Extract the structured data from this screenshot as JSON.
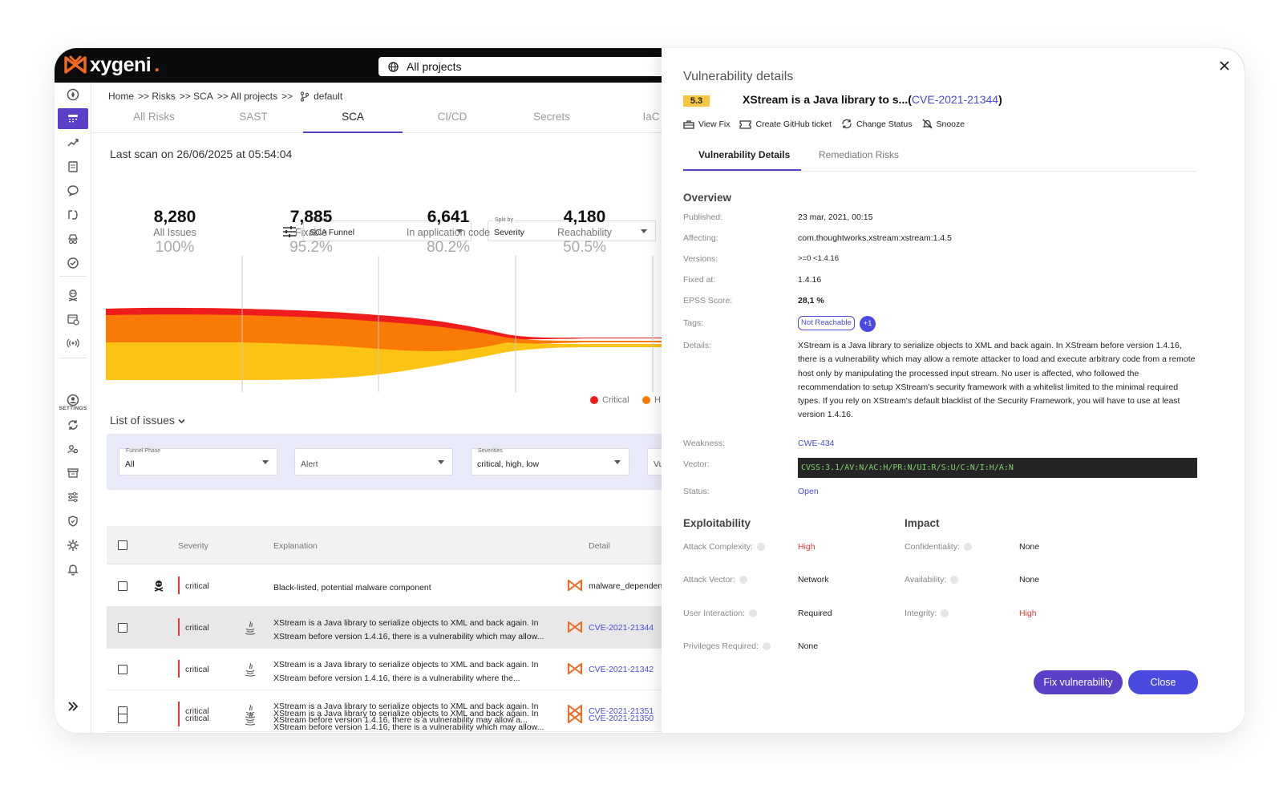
{
  "brand": {
    "name": "xygeni",
    "accent": "#f26a21",
    "primary": "#5b3fc8",
    "link": "#4a4ae0"
  },
  "header": {
    "project_selector": "All projects"
  },
  "sidebar": {
    "settings_label": "SETTINGS"
  },
  "breadcrumb": {
    "items": [
      "Home",
      ">> Risks",
      ">> SCA",
      ">> All projects",
      ">>"
    ],
    "branch": "default"
  },
  "tabs": [
    "All Risks",
    "SAST",
    "SCA",
    "CI/CD",
    "Secrets",
    "IaC"
  ],
  "active_tab": "SCA",
  "last_scan": "Last scan on 26/06/2025 at 05:54:04",
  "funnel_select": {
    "label": "Funnel",
    "value": "SCA Funnel"
  },
  "split_select": {
    "label": "Split by",
    "value": "Severity"
  },
  "metrics": [
    {
      "number": "8,280",
      "label": "All Issues",
      "percent": "100%"
    },
    {
      "number": "7,885",
      "label": "Fixable",
      "percent": "95.2%"
    },
    {
      "number": "6,641",
      "label": "In application code",
      "percent": "80.2%"
    },
    {
      "number": "4,180",
      "label": "Reachability",
      "percent": "50.5%"
    }
  ],
  "funnel_colors": {
    "critical": "#ee1c1c",
    "high": "#f97a07",
    "medium": "#fbc313"
  },
  "legend": {
    "critical": "Critical",
    "high": "H"
  },
  "list_header": "List of issues",
  "filters": [
    {
      "label": "Funnel Phase",
      "value": "All"
    },
    {
      "label": "",
      "value": "Alert"
    },
    {
      "label": "Severities",
      "value": "critical, high, low"
    },
    {
      "label": "",
      "value": "Vu"
    }
  ],
  "table": {
    "columns": [
      "Severity",
      "Explanation",
      "Detail"
    ],
    "rows": [
      {
        "severity": "critical",
        "explanation": "Black-listed, potential malware component",
        "detail": "malware_dependen"
      },
      {
        "severity": "critical",
        "explanation": "XStream is a Java library to serialize objects to XML and back again. In XStream before version 1.4.16, there is a vulnerability which may allow...",
        "detail": "CVE-2021-21344"
      },
      {
        "severity": "critical",
        "explanation": "XStream is a Java library to serialize objects to XML and back again. In XStream before version 1.4.16, there is a vulnerability where the...",
        "detail": "CVE-2021-21342"
      },
      {
        "severity": "critical",
        "explanation": "XStream is a Java library to serialize objects to XML and back again. In XStream before version 1.4.16, there is a vulnerability may allow a...",
        "detail": "CVE-2021-21351"
      },
      {
        "severity": "critical",
        "explanation": "XStream is a Java library to serialize objects to XML and back again. In XStream before version 1.4.16, there is a vulnerability which may allow...",
        "detail": "CVE-2021-21350"
      }
    ]
  },
  "panel": {
    "title": "Vulnerability details",
    "score": "5.3",
    "headline": "XStream is a Java library to s...(",
    "cve": "CVE-2021-21344",
    "headline_end": ")",
    "actions": [
      "View Fix",
      "Create GitHub ticket",
      "Change Status",
      "Snooze"
    ],
    "tabs": [
      "Vulnerability Details",
      "Remediation Risks"
    ],
    "overview_title": "Overview",
    "fields": {
      "published_k": "Published:",
      "published_v": "23 mar, 2021, 00:15",
      "affecting_k": "Affecting:",
      "affecting_v": "com.thoughtworks.xstream:xstream:1.4.5",
      "versions_k": "Versions:",
      "versions_v": ">=0 <1.4.16",
      "fixed_k": "Fixed at:",
      "fixed_v": "1.4.16",
      "epss_k": "EPSS Score:",
      "epss_v": "28,1 %",
      "tags_k": "Tags:",
      "tag1": "Not Reachable",
      "tag2": "+1",
      "details_k": "Details:",
      "details_v": "XStream is a Java library to serialize objects to XML and back again. In XStream before version 1.4.16, there is a vulnerability which may allow a remote attacker to load and execute arbitrary code from a remote host only by manipulating the processed input stream. No user is affected, who followed the recommendation to setup XStream's security framework with a whitelist limited to the minimal required types. If you rely on XStream's default blacklist of the Security Framework, you will have to use at least version 1.4.16.",
      "weakness_k": "Weakness:",
      "weakness_v": "CWE-434",
      "vector_k": "Vector:",
      "vector_v": "CVSS:3.1/AV:N/AC:H/PR:N/UI:R/S:U/C:N/I:H/A:N",
      "status_k": "Status:",
      "status_v": "Open"
    },
    "exploitability_title": "Exploitability",
    "impact_title": "Impact",
    "exploitability": [
      {
        "k": "Attack Complexity:",
        "v": "High",
        "color": "#e53935"
      },
      {
        "k": "Attack Vector:",
        "v": "Network",
        "color": "#222222"
      },
      {
        "k": "User Interaction:",
        "v": "Required",
        "color": "#222222"
      },
      {
        "k": "Privileges Required:",
        "v": "None",
        "color": "#222222"
      }
    ],
    "impact": [
      {
        "k": "Confidentiality:",
        "v": "None",
        "color": "#222222"
      },
      {
        "k": "Availability:",
        "v": "None",
        "color": "#222222"
      },
      {
        "k": "Integrity:",
        "v": "High",
        "color": "#e53935"
      }
    ],
    "fix_button": "Fix vulnerability",
    "close_button": "Close"
  }
}
